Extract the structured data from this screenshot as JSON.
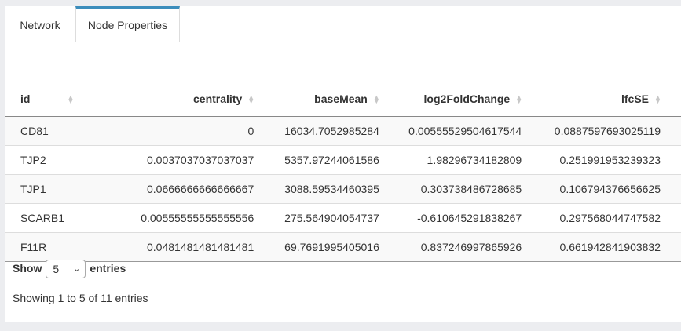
{
  "tabs": [
    {
      "label": "Network",
      "active": false
    },
    {
      "label": "Node Properties",
      "active": true
    }
  ],
  "table": {
    "columns": [
      "id",
      "centrality",
      "baseMean",
      "log2FoldChange",
      "lfcSE"
    ],
    "rows": [
      [
        "CD81",
        "0",
        "16034.7052985284",
        "0.00555529504617544",
        "0.0887597693025119"
      ],
      [
        "TJP2",
        "0.0037037037037037",
        "5357.97244061586",
        "1.98296734182809",
        "0.251991953239323"
      ],
      [
        "TJP1",
        "0.0666666666666667",
        "3088.59534460395",
        "0.303738486728685",
        "0.106794376656625"
      ],
      [
        "SCARB1",
        "0.00555555555555556",
        "275.564904054737",
        "-0.610645291838267",
        "0.297568044747582"
      ],
      [
        "F11R",
        "0.0481481481481481",
        "69.7691995405016",
        "0.837246997865926",
        "0.661942841903832"
      ]
    ]
  },
  "length": {
    "show_label": "Show",
    "selected": "5",
    "entries_label": "entries"
  },
  "info": "Showing 1 to 5 of 11 entries",
  "colors": {
    "accent": "#3c8dbc",
    "stripe": "#f9f9f9"
  }
}
